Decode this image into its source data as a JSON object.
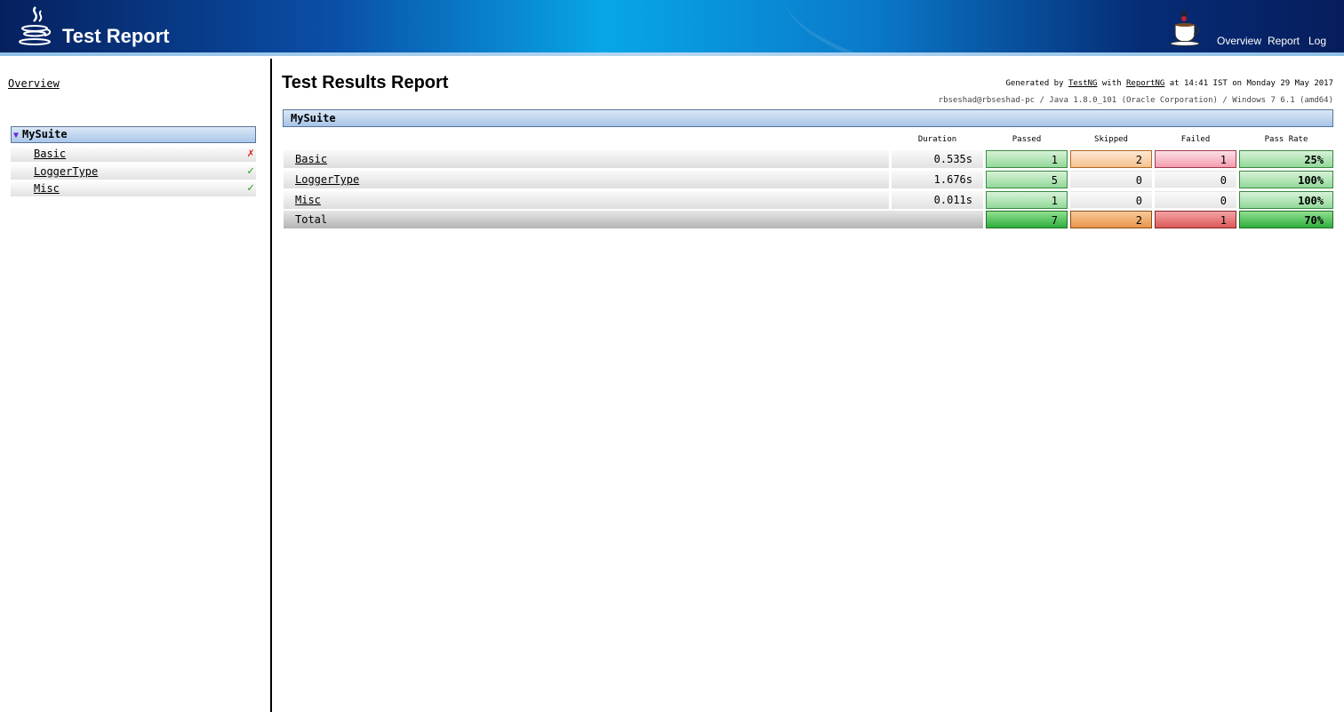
{
  "header": {
    "title": "Test Report",
    "nav": [
      "Overview",
      "Report",
      "Log"
    ]
  },
  "sidebar": {
    "overview_link": "Overview",
    "suite": {
      "name": "MySuite",
      "toggle": "▼"
    },
    "tests": [
      {
        "name": "Basic",
        "status": "fail",
        "mark": "✗"
      },
      {
        "name": "LoggerType",
        "status": "pass",
        "mark": "✓"
      },
      {
        "name": "Misc",
        "status": "pass",
        "mark": "✓"
      }
    ]
  },
  "main": {
    "title": "Test Results Report",
    "generated": {
      "prefix": "Generated by",
      "tool1": "TestNG",
      "with": "with",
      "tool2": "ReportNG",
      "suffix": "at 14:41 IST on Monday 29 May 2017"
    },
    "system_info": "rbseshad@rbseshad-pc / Java 1.8.0_101 (Oracle Corporation) / Windows 7 6.1 (amd64)",
    "suite_name": "MySuite",
    "columns": {
      "duration": "Duration",
      "passed": "Passed",
      "skipped": "Skipped",
      "failed": "Failed",
      "pass_rate": "Pass Rate"
    },
    "rows": [
      {
        "name": "Basic",
        "duration": "0.535s",
        "passed": "1",
        "skipped": "2",
        "failed": "1",
        "pass_rate": "25%"
      },
      {
        "name": "LoggerType",
        "duration": "1.676s",
        "passed": "5",
        "skipped": "0",
        "failed": "0",
        "pass_rate": "100%"
      },
      {
        "name": "Misc",
        "duration": "0.011s",
        "passed": "1",
        "skipped": "0",
        "failed": "0",
        "pass_rate": "100%"
      }
    ],
    "total": {
      "label": "Total",
      "passed": "7",
      "skipped": "2",
      "failed": "1",
      "pass_rate": "70%"
    }
  },
  "colors": {
    "passed": "#93d99a",
    "skipped": "#f6c28f",
    "failed": "#f39cae",
    "header_bg": "#08a6e6",
    "fail_mark": "#e02020",
    "pass_mark": "#22a32a"
  }
}
